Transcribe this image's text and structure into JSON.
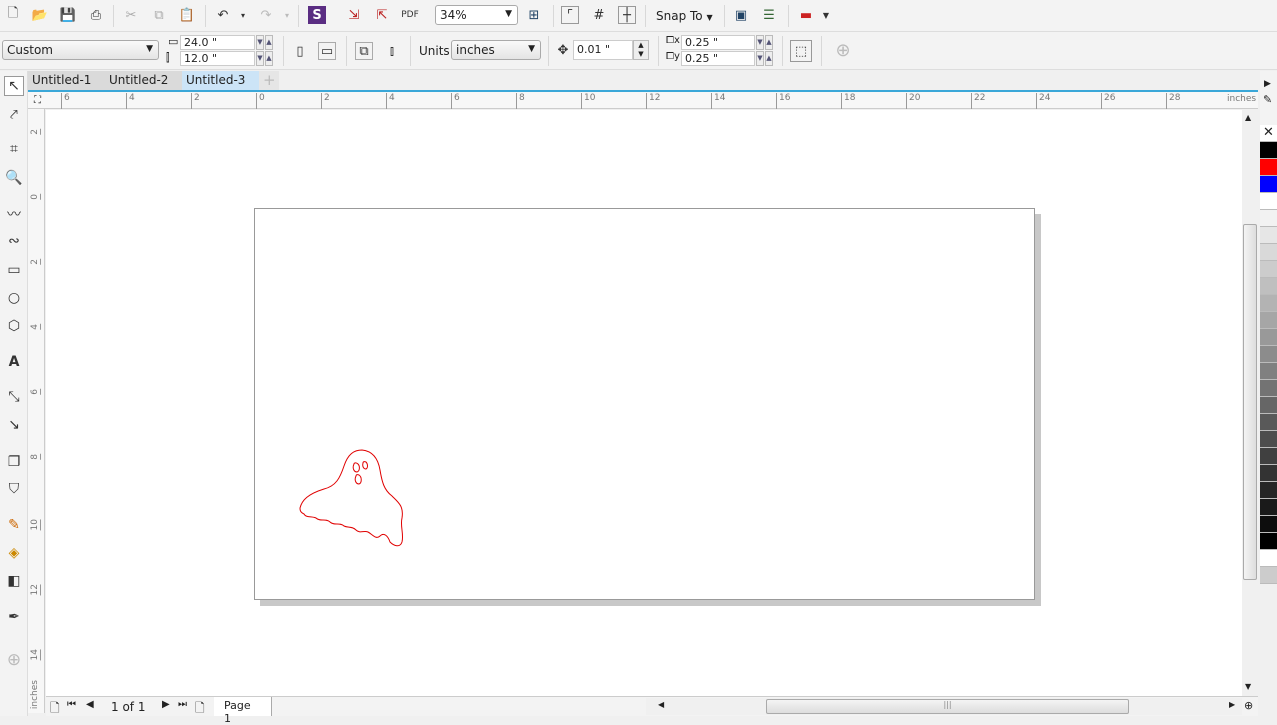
{
  "toolbar": {
    "zoom": "34%",
    "snap_to": "Snap To"
  },
  "property_bar": {
    "page_size": "Custom",
    "width": "24.0 \"",
    "height": "12.0 \"",
    "units_label": "Units:",
    "units": "inches",
    "nudge": "0.01 \"",
    "dup_x": "0.25 \"",
    "dup_y": "0.25 \""
  },
  "tabs": [
    {
      "label": "Untitled-1"
    },
    {
      "label": "Untitled-2"
    },
    {
      "label": "Untitled-3",
      "active": true
    }
  ],
  "ruler": {
    "unit": "inches",
    "h_ticks": [
      "6",
      "4",
      "2",
      "0",
      "2",
      "4",
      "6",
      "8",
      "10",
      "12",
      "14",
      "16",
      "18",
      "20",
      "22",
      "24",
      "26",
      "28"
    ],
    "v_ticks": [
      "2",
      "0",
      "2",
      "4",
      "6",
      "8",
      "10",
      "12",
      "14"
    ]
  },
  "status": {
    "page_count": "1 of 1",
    "page_tab": "Page 1"
  },
  "palette": {
    "colors": [
      "#000000",
      "#ff0000",
      "#0000ff",
      "#ffffff",
      "#f2f2f2",
      "#e6e6e6",
      "#d9d9d9",
      "#cccccc",
      "#bfbfbf",
      "#b3b3b3",
      "#a6a6a6",
      "#999999",
      "#8c8c8c",
      "#808080",
      "#737373",
      "#666666",
      "#595959",
      "#4d4d4d",
      "#404040",
      "#333333",
      "#262626",
      "#1a1a1a",
      "#0d0d0d",
      "#000000",
      "#ffffff",
      "#cccccc"
    ]
  },
  "drawing": {
    "stroke": "#e00000"
  }
}
